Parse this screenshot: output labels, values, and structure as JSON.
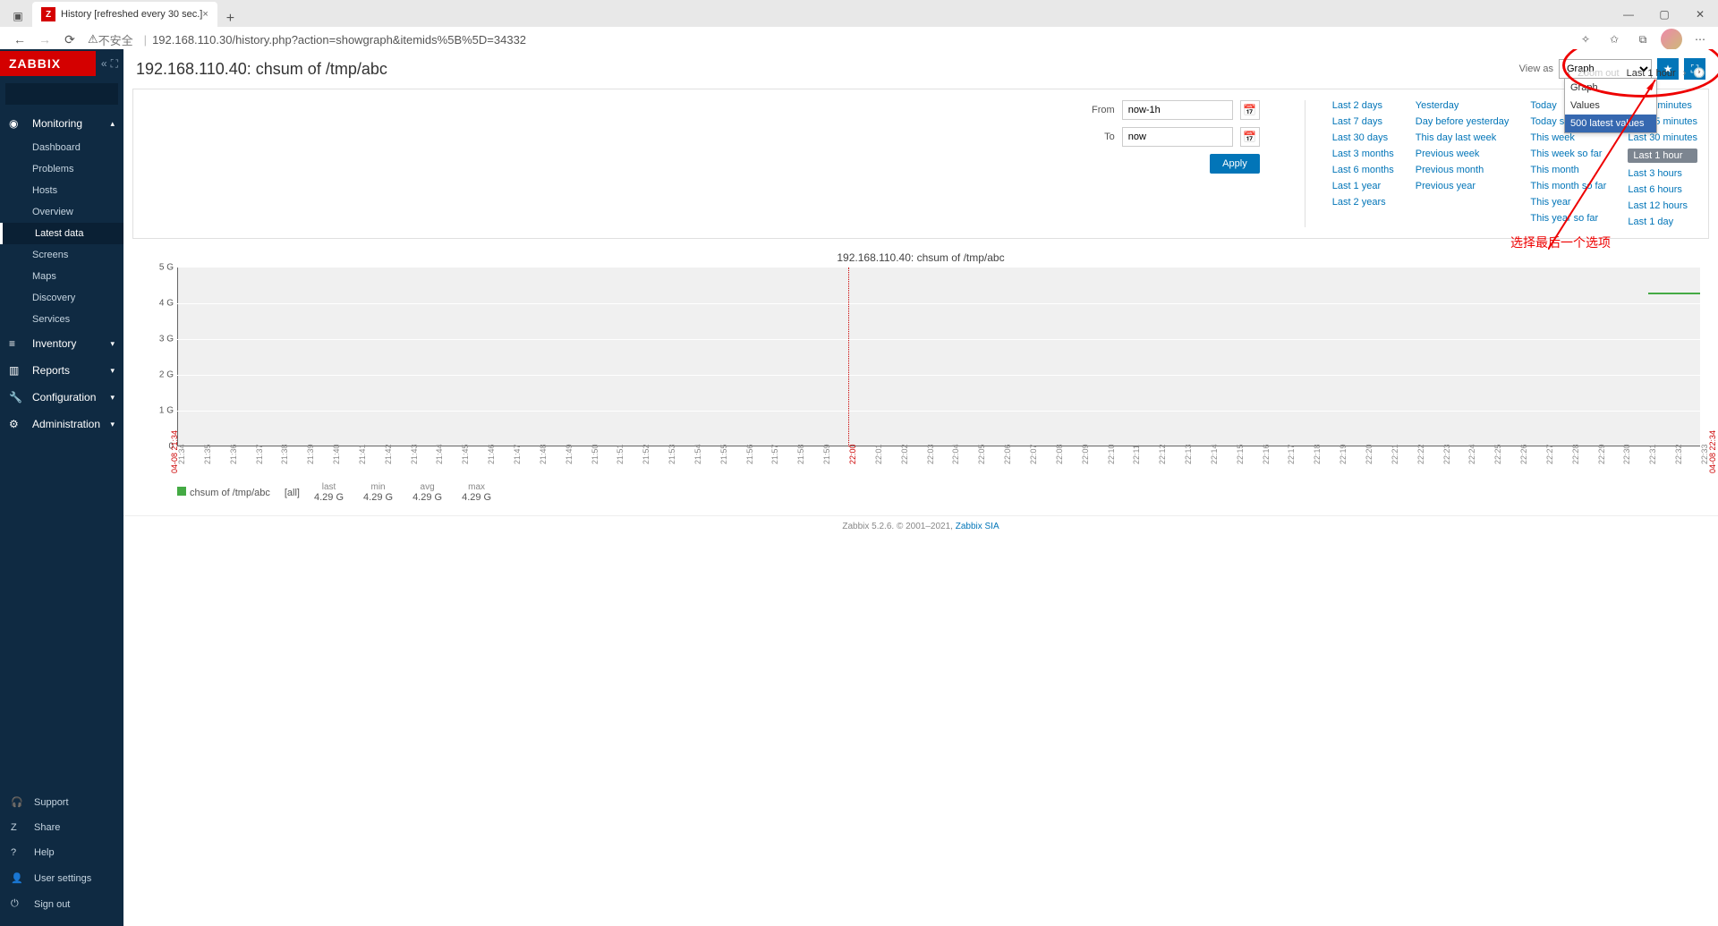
{
  "browser": {
    "tab_title": "History [refreshed every 30 sec.]",
    "insecure_label": "不安全",
    "url": "192.168.110.30/history.php?action=showgraph&itemids%5B%5D=34332"
  },
  "sidebar": {
    "logo": "ZABBIX",
    "sections": {
      "monitoring": "Monitoring",
      "inventory": "Inventory",
      "reports": "Reports",
      "configuration": "Configuration",
      "administration": "Administration"
    },
    "monitoring_items": [
      "Dashboard",
      "Problems",
      "Hosts",
      "Overview",
      "Latest data",
      "Screens",
      "Maps",
      "Discovery",
      "Services"
    ],
    "bottom": {
      "support": "Support",
      "share": "Share",
      "help": "Help",
      "user": "User settings",
      "signout": "Sign out"
    }
  },
  "page": {
    "title": "192.168.110.40: chsum of /tmp/abc",
    "view_as_label": "View as",
    "view_as_value": "Graph",
    "dropdown_options": [
      "Graph",
      "Values",
      "500 latest values"
    ]
  },
  "zoom": {
    "zoom_out": "Zoom out",
    "current": "Last 1 hour"
  },
  "filter": {
    "from_label": "From",
    "from_value": "now-1h",
    "to_label": "To",
    "to_value": "now",
    "apply": "Apply"
  },
  "quick": {
    "col1": [
      "Last 2 days",
      "Last 7 days",
      "Last 30 days",
      "Last 3 months",
      "Last 6 months",
      "Last 1 year",
      "Last 2 years"
    ],
    "col2": [
      "Yesterday",
      "Day before yesterday",
      "This day last week",
      "Previous week",
      "Previous month",
      "Previous year"
    ],
    "col3": [
      "Today",
      "Today so far",
      "This week",
      "This week so far",
      "This month",
      "This month so far",
      "This year",
      "This year so far"
    ],
    "col4": [
      "Last 5 minutes",
      "Last 15 minutes",
      "Last 30 minutes",
      "Last 1 hour",
      "Last 3 hours",
      "Last 6 hours",
      "Last 12 hours",
      "Last 1 day"
    ]
  },
  "annotation": {
    "text": "选择最后一个选项"
  },
  "chart_data": {
    "type": "line",
    "title": "192.168.110.40: chsum of /tmp/abc",
    "ylabel": "",
    "ylim": [
      0,
      5
    ],
    "y_unit": "G",
    "y_ticks": [
      0,
      1,
      2,
      3,
      4,
      5
    ],
    "x_start": "04-08 21:34",
    "x_end": "04-08 22:34",
    "x_ticks": [
      "21:34",
      "21:35",
      "21:36",
      "21:37",
      "21:38",
      "21:39",
      "21:40",
      "21:41",
      "21:42",
      "21:43",
      "21:44",
      "21:45",
      "21:46",
      "21:47",
      "21:48",
      "21:49",
      "21:50",
      "21:51",
      "21:52",
      "21:53",
      "21:54",
      "21:55",
      "21:56",
      "21:57",
      "21:58",
      "21:59",
      "22:00",
      "22:01",
      "22:02",
      "22:03",
      "22:04",
      "22:05",
      "22:06",
      "22:07",
      "22:08",
      "22:09",
      "22:10",
      "22:11",
      "22:12",
      "22:13",
      "22:14",
      "22:15",
      "22:16",
      "22:17",
      "22:18",
      "22:19",
      "22:20",
      "22:21",
      "22:22",
      "22:23",
      "22:24",
      "22:25",
      "22:26",
      "22:27",
      "22:28",
      "22:29",
      "22:30",
      "22:31",
      "22:32",
      "22:33"
    ],
    "series": [
      {
        "name": "chsum of /tmp/abc",
        "values_range": [
          "22:31",
          "22:34"
        ],
        "value": 4.29,
        "color": "#44aa44"
      }
    ]
  },
  "legend": {
    "name": "chsum of /tmp/abc",
    "scope": "[all]",
    "stats": {
      "last": "4.29 G",
      "min": "4.29 G",
      "avg": "4.29 G",
      "max": "4.29 G"
    },
    "labels": {
      "last": "last",
      "min": "min",
      "avg": "avg",
      "max": "max"
    }
  },
  "footer": {
    "text": "Zabbix 5.2.6. © 2001–2021, ",
    "link": "Zabbix SIA"
  }
}
